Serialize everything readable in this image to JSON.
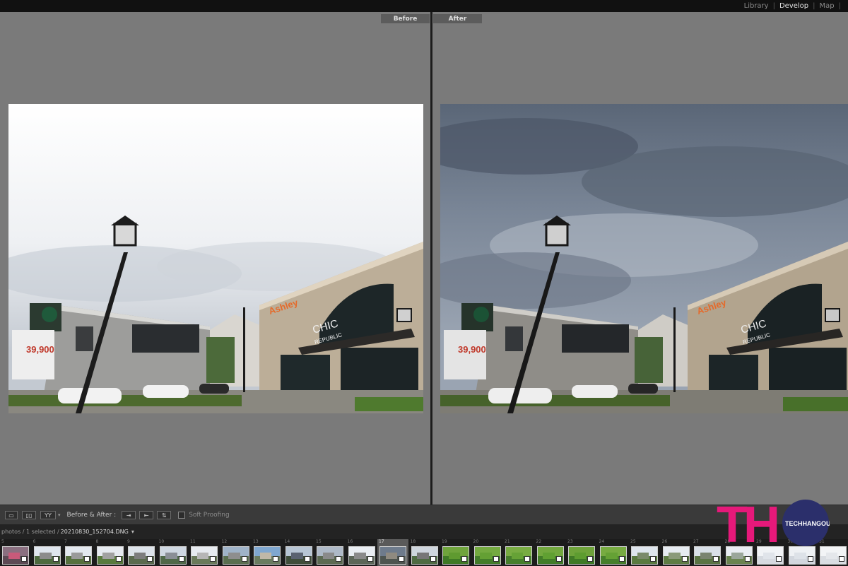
{
  "modules": [
    "Library",
    "Develop",
    "Map",
    "|"
  ],
  "active_module": "Develop",
  "panes": {
    "before_label": "Before",
    "after_label": "After"
  },
  "toolbar": {
    "view_loupe_label": "",
    "view_compare_label": "",
    "view_yy_label": "YY",
    "before_after_label": "Before & After :",
    "soft_proofing_label": "Soft Proofing"
  },
  "filmstrip_header": {
    "count_text": "photos / 1 selected /",
    "filename": "20210830_152704.DNG",
    "dropdown_glyph": "▾"
  },
  "filmstrip": {
    "selected_number": "17",
    "items": [
      {
        "num": "5",
        "sky": "#8a6f80",
        "ground": "#5d4a55",
        "bld": "#c85a7a"
      },
      {
        "num": "6",
        "sky": "#dfe6ee",
        "ground": "#4d6a3f",
        "bld": "#8c8c8c"
      },
      {
        "num": "7",
        "sky": "#e3e8ef",
        "ground": "#56703e",
        "bld": "#9a9a9a"
      },
      {
        "num": "8",
        "sky": "#e6eaf0",
        "ground": "#587a3e",
        "bld": "#a1a1a1"
      },
      {
        "num": "9",
        "sky": "#dde3ea",
        "ground": "#5a6a4e",
        "bld": "#7d7d7d"
      },
      {
        "num": "10",
        "sky": "#cfd8e2",
        "ground": "#4f6848",
        "bld": "#8a8f96"
      },
      {
        "num": "11",
        "sky": "#e7ebf0",
        "ground": "#6a7a5a",
        "bld": "#b6b6b6"
      },
      {
        "num": "12",
        "sky": "#9fb3c8",
        "ground": "#5a6f50",
        "bld": "#8e8e8e"
      },
      {
        "num": "13",
        "sky": "#7fa7d0",
        "ground": "#6a7c60",
        "bld": "#c0b8a8"
      },
      {
        "num": "14",
        "sky": "#b7c5d4",
        "ground": "#3f4d3a",
        "bld": "#5a6270"
      },
      {
        "num": "15",
        "sky": "#aeb9c7",
        "ground": "#5c6a52",
        "bld": "#8a8a8a"
      },
      {
        "num": "16",
        "sky": "#e9edf2",
        "ground": "#5c6658",
        "bld": "#8a8a8a"
      },
      {
        "num": "17",
        "sky": "#6e7b8c",
        "ground": "#4e5550",
        "bld": "#8f8a80"
      },
      {
        "num": "18",
        "sky": "#cfd6de",
        "ground": "#4f6b43",
        "bld": "#777"
      },
      {
        "num": "19",
        "sky": "#6fa43c",
        "ground": "#3f7a26",
        "bld": "#5f9a30"
      },
      {
        "num": "20",
        "sky": "#74aa40",
        "ground": "#437d2a",
        "bld": "#64a034"
      },
      {
        "num": "21",
        "sky": "#78ac42",
        "ground": "#467f2c",
        "bld": "#66a236"
      },
      {
        "num": "22",
        "sky": "#72a83e",
        "ground": "#417c28",
        "bld": "#60a032"
      },
      {
        "num": "23",
        "sky": "#6ea33a",
        "ground": "#3f7a26",
        "bld": "#5d9c30"
      },
      {
        "num": "24",
        "sky": "#77ab41",
        "ground": "#457e2b",
        "bld": "#65a135"
      },
      {
        "num": "25",
        "sky": "#dfe6ee",
        "ground": "#5a7a40",
        "bld": "#7a8a6a"
      },
      {
        "num": "26",
        "sky": "#e6ebf1",
        "ground": "#5e7c44",
        "bld": "#8a9a7a"
      },
      {
        "num": "27",
        "sky": "#d9e0e8",
        "ground": "#5a7444",
        "bld": "#7a8470"
      },
      {
        "num": "28",
        "sky": "#e9edf2",
        "ground": "#6a8450",
        "bld": "#9aa69a"
      },
      {
        "num": "29",
        "sky": "#f1f3f6",
        "ground": "#d6dae0",
        "bld": "#e0e4ea"
      },
      {
        "num": "30",
        "sky": "#eef1f4",
        "ground": "#d2d7de",
        "bld": "#dde2e8"
      },
      {
        "num": "31",
        "sky": "#f2f4f6",
        "ground": "#d9dde2",
        "bld": "#e4e7eb"
      }
    ]
  },
  "photo": {
    "store_sign_1": "Ashley",
    "store_sign_2": "CHIC",
    "store_sign_3": "REPUBLIC",
    "billboard_price": "39,900"
  },
  "logo": {
    "letters": "TH",
    "text": "TECHHANGOUT",
    "pink": "#e6197a",
    "navy": "#2b2f6b"
  }
}
